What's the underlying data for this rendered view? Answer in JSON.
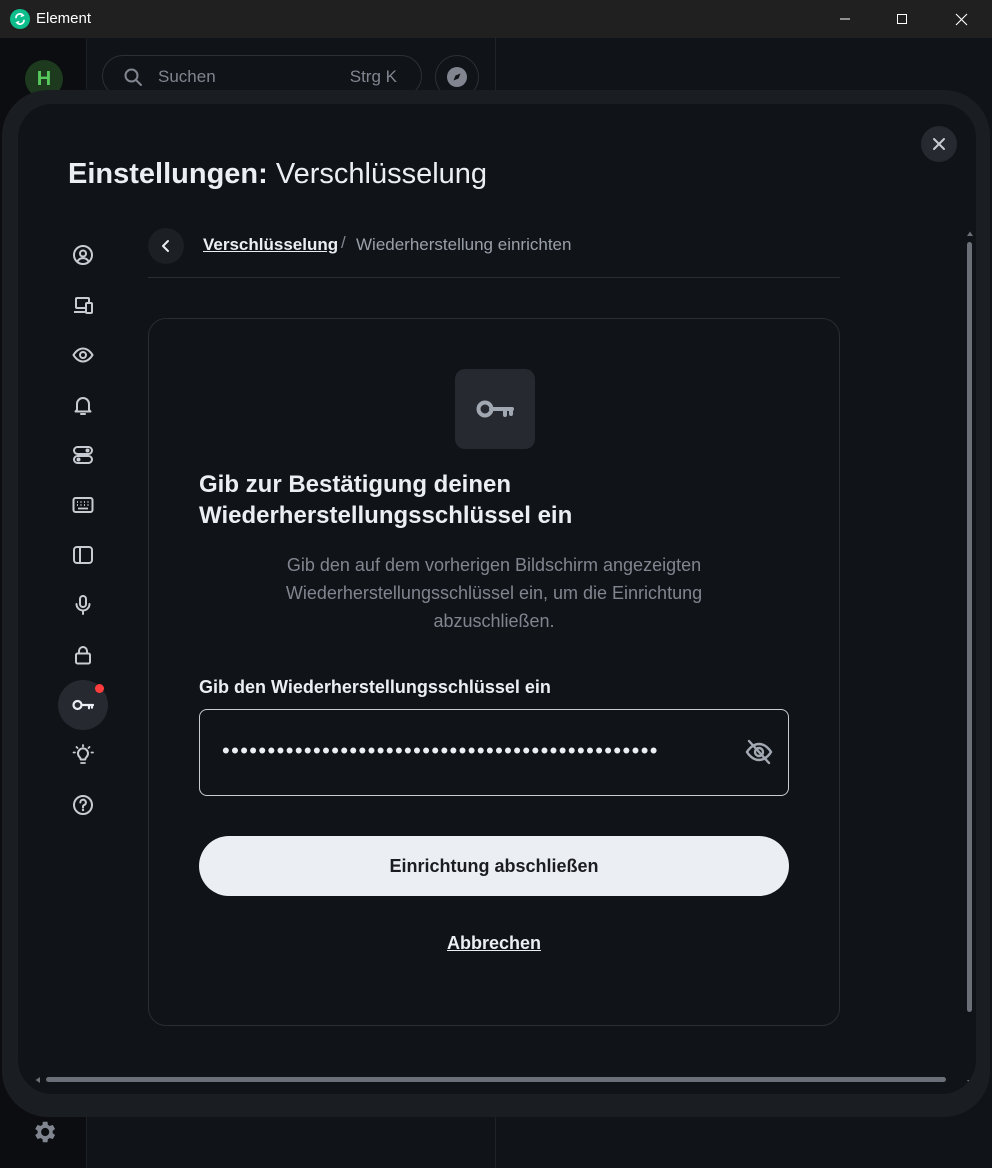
{
  "window": {
    "title": "Element",
    "accent": "#0dbd8b",
    "controls": [
      "minimize-icon",
      "maximize-icon",
      "close-icon"
    ]
  },
  "background": {
    "space_avatar": "H",
    "search": {
      "placeholder": "Suchen",
      "shortcut": "Strg K"
    }
  },
  "modal": {
    "title_bold": "Einstellungen:",
    "title_rest": " Verschlüsselung",
    "sidebar": [
      {
        "icon": "user-profile-icon",
        "active": false
      },
      {
        "icon": "devices-icon",
        "active": false
      },
      {
        "icon": "eye-icon",
        "active": false
      },
      {
        "icon": "bell-icon",
        "active": false
      },
      {
        "icon": "preferences-toggle-icon",
        "active": false
      },
      {
        "icon": "keyboard-icon",
        "active": false
      },
      {
        "icon": "sidebar-layout-icon",
        "active": false
      },
      {
        "icon": "microphone-icon",
        "active": false
      },
      {
        "icon": "lock-icon",
        "active": false
      },
      {
        "icon": "key-icon",
        "active": true,
        "badge": true
      },
      {
        "icon": "lightbulb-icon",
        "active": false
      },
      {
        "icon": "help-icon",
        "active": false
      }
    ],
    "breadcrumb": {
      "parent": "Verschlüsselung",
      "separator": "/",
      "current": "Wiederherstellung einrichten"
    },
    "card": {
      "icon": "key-icon",
      "heading": "Gib zur Bestätigung deinen Wiederherstellungsschlüssel ein",
      "description": "Gib den auf dem vorherigen Bildschirm angezeigten Wiederherstellungsschlüssel ein, um die Einrichtung abzuschließen.",
      "field_label": "Gib den Wiederherstellungsschlüssel ein",
      "field_value": "••••••••••••••••••••••••••••••••••••••••••••••••",
      "visibility_icon": "eye-off-icon",
      "primary_button": "Einrichtung abschließen",
      "cancel_link": "Abbrechen"
    },
    "badge_color": "#ff3d3d"
  }
}
